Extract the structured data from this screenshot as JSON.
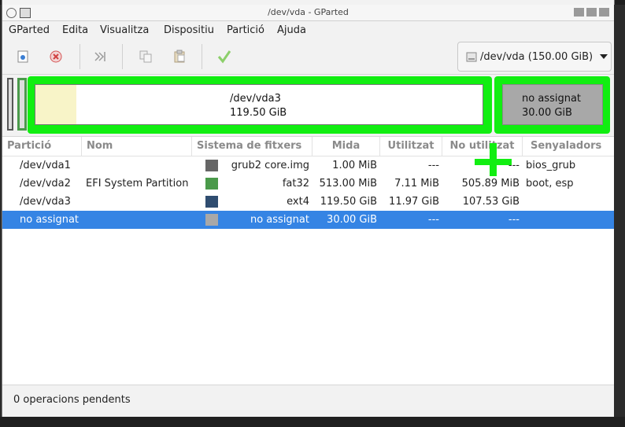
{
  "window": {
    "title": "/dev/vda - GParted"
  },
  "menu": [
    "GParted",
    "Edita",
    "Visualitza",
    "Dispositiu",
    "Partició",
    "Ajuda"
  ],
  "toolbar": {
    "icons": [
      "new-icon",
      "delete-icon",
      "resize-move-icon",
      "copy-icon",
      "paste-icon",
      "apply-icon"
    ],
    "device": "/dev/vda (150.00 GiB)"
  },
  "disk_map": {
    "partitions": [
      {
        "name": "/dev/vda3",
        "size": "119.50 GiB"
      },
      {
        "name": "no assignat",
        "size": "30.00 GiB"
      }
    ]
  },
  "table": {
    "headers": [
      "Partició",
      "Nom",
      "Sistema de fitxers",
      "Mida",
      "Utilitzat",
      "No utilitzat",
      "Senyaladors"
    ],
    "rows": [
      {
        "partition": "/dev/vda1",
        "name": "",
        "fs_color": "#666666",
        "fs": "grub2 core.img",
        "size": "1.00 MiB",
        "used": "---",
        "unused": "---",
        "flags": "bios_grub"
      },
      {
        "partition": "/dev/vda2",
        "name": "EFI System Partition",
        "fs_color": "#4a9a4a",
        "fs": "fat32",
        "size": "513.00 MiB",
        "used": "7.11 MiB",
        "unused": "505.89 MiB",
        "flags": "boot, esp"
      },
      {
        "partition": "/dev/vda3",
        "name": "",
        "fs_color": "#2f4d70",
        "fs": "ext4",
        "size": "119.50 GiB",
        "used": "11.97 GiB",
        "unused": "107.53 GiB",
        "flags": ""
      },
      {
        "partition": "no assignat",
        "name": "",
        "fs_color": "#a8a8a8",
        "fs": "no assignat",
        "size": "30.00 GiB",
        "used": "---",
        "unused": "---",
        "flags": ""
      }
    ]
  },
  "status": {
    "text": "0 operacions pendents"
  },
  "colors": {
    "selection": "#3584e4",
    "highlight": "#11ee11",
    "unallocated": "#a8a8a8"
  }
}
